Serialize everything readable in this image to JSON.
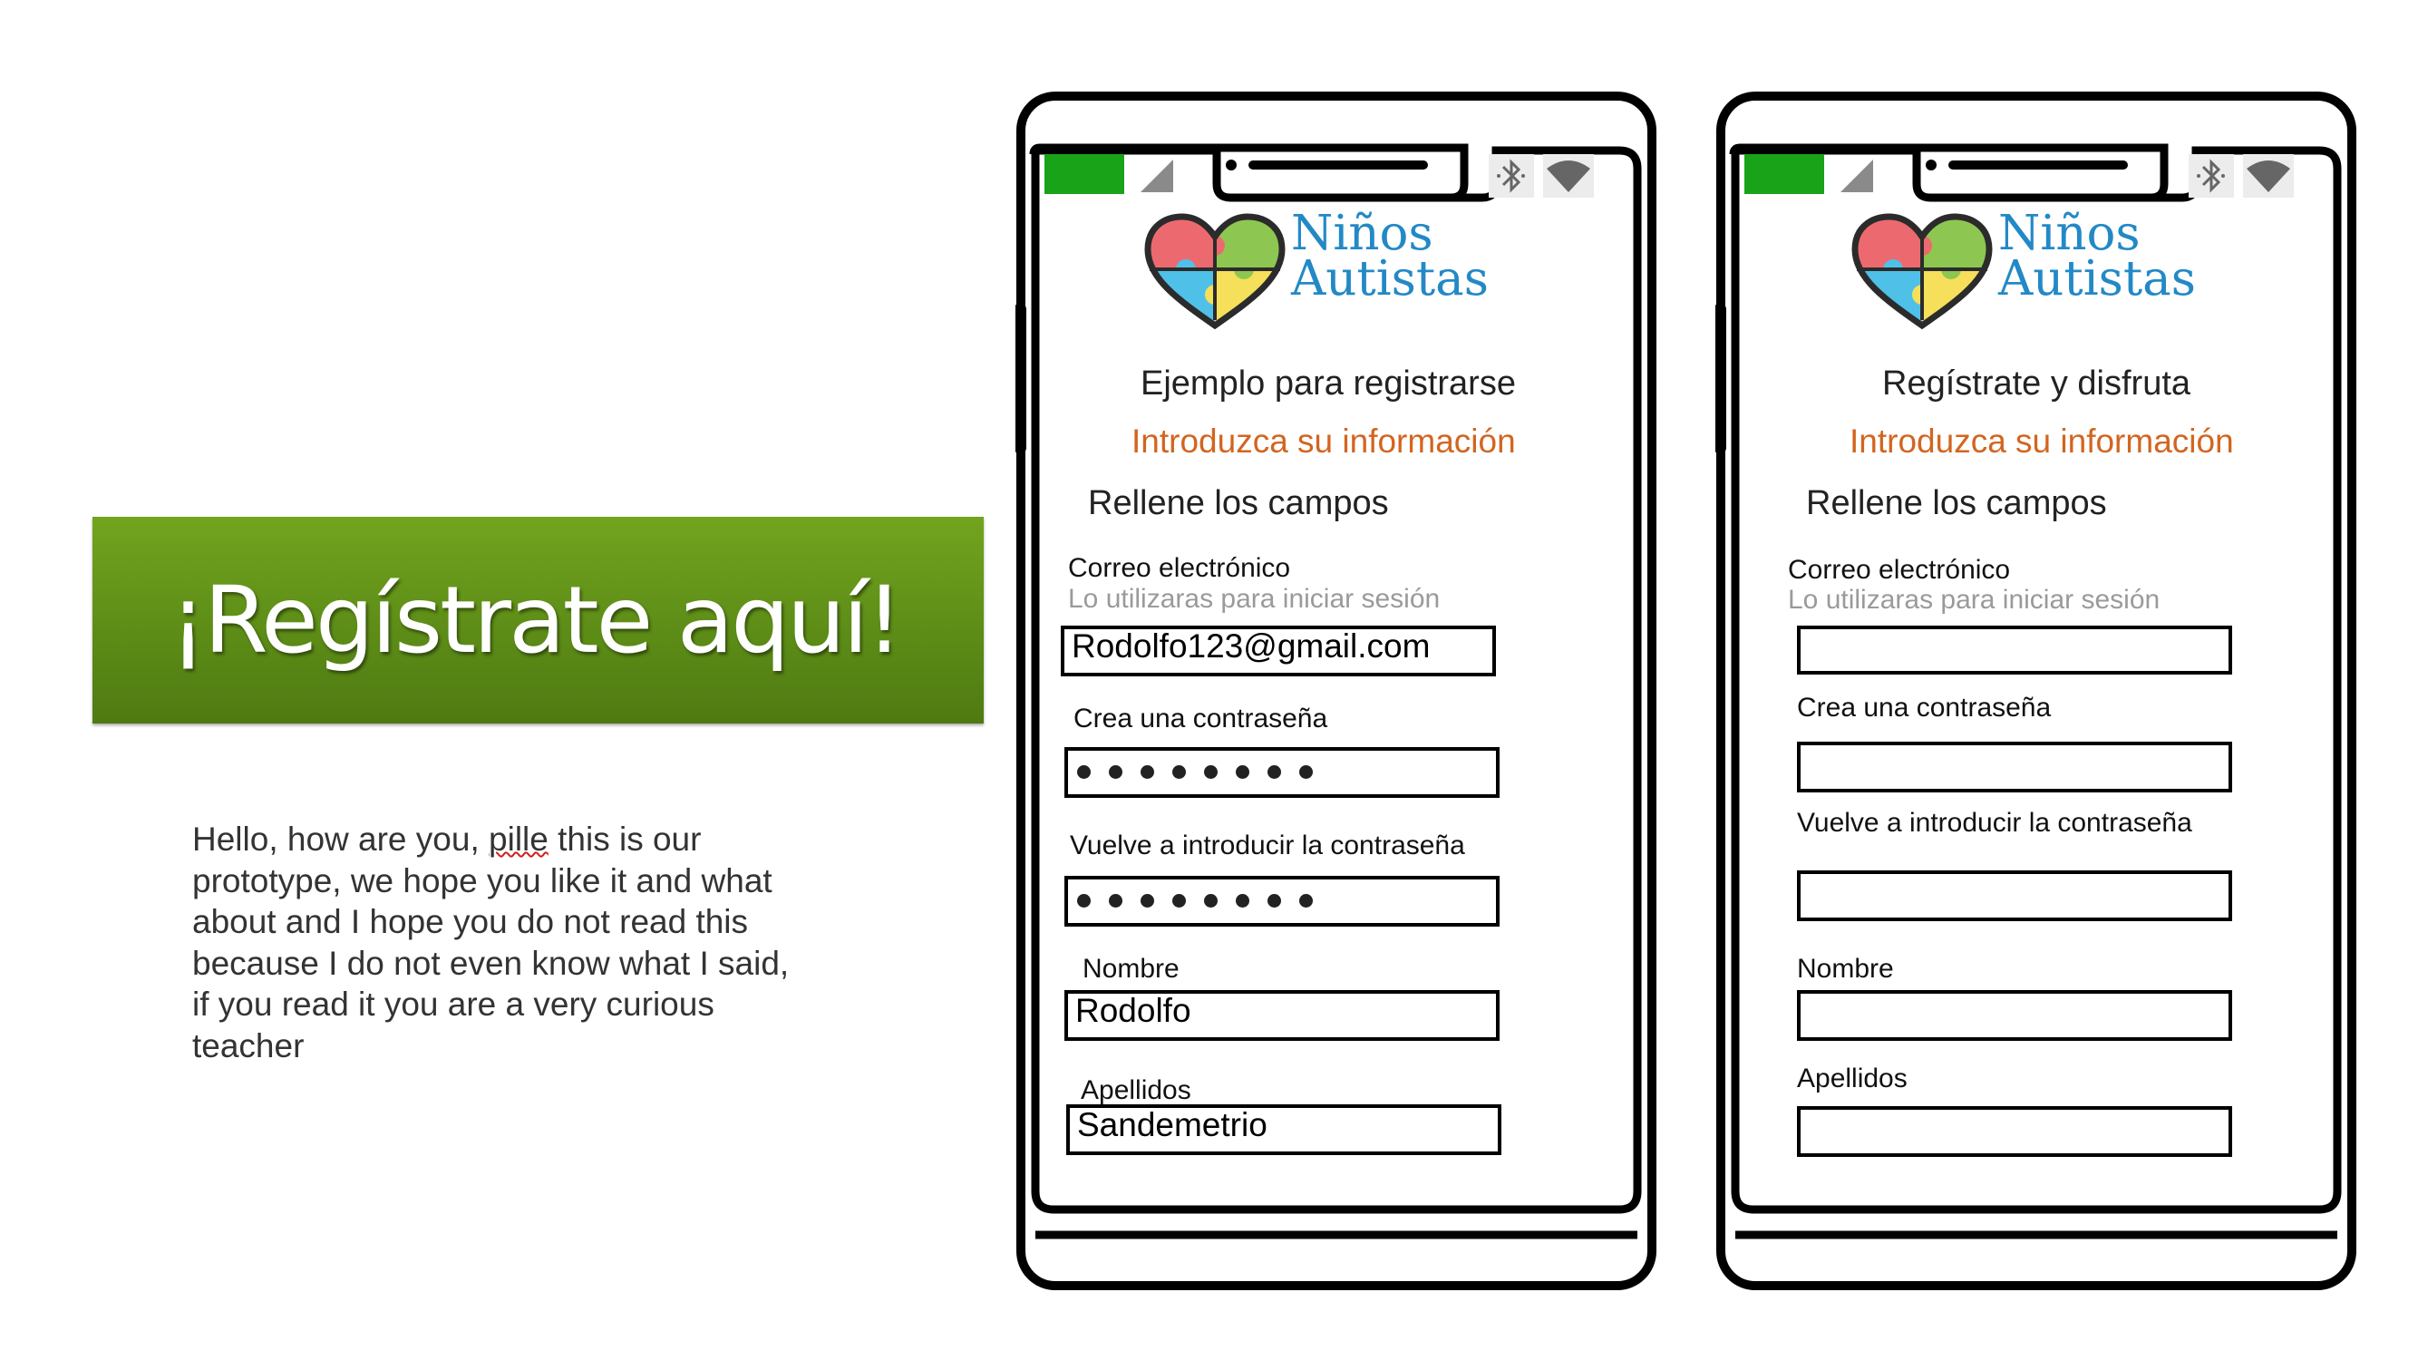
{
  "banner": {
    "text": "¡Regístrate aquí!"
  },
  "note": {
    "prefix": "Hello, how are you, ",
    "misspelled": "pille",
    "suffix": " this is our prototype, we hope you like it and what about and I hope you do not read this because I do not even know what I said, if you read it you are a very curious teacher"
  },
  "colors": {
    "banner": "#5d8d17",
    "accent": "#d26520",
    "logo_text": "#2389c6",
    "battery": "#19a319"
  },
  "phones": [
    {
      "logo": {
        "line1": "Niños",
        "line2": "Autistas"
      },
      "title": "Ejemplo para registrarse",
      "subtitle": "Introduzca su información",
      "instruction": "Rellene los campos",
      "fields": {
        "email_label": "Correo electrónico",
        "email_hint": "Lo utilizaras para iniciar sesión",
        "email_value": "Rodolfo123@gmail.com",
        "password_label": "Crea una contraseña",
        "password_dots": 8,
        "confirm_label": "Vuelve a introducir la contraseña",
        "confirm_dots": 8,
        "name_label": "Nombre",
        "name_value": "Rodolfo",
        "surname_label": "Apellidos",
        "surname_value": "Sandemetrio"
      }
    },
    {
      "logo": {
        "line1": "Niños",
        "line2": "Autistas"
      },
      "title": "Regístrate y disfruta",
      "subtitle": "Introduzca su información",
      "instruction": "Rellene los campos",
      "fields": {
        "email_label": "Correo electrónico",
        "email_hint": "Lo utilizaras para iniciar sesión",
        "email_value": "",
        "password_label": "Crea una contraseña",
        "confirm_label": "Vuelve a introducir la contraseña",
        "name_label": "Nombre",
        "name_value": "",
        "surname_label": "Apellidos",
        "surname_value": ""
      }
    }
  ],
  "icons": [
    "battery-icon",
    "signal-icon",
    "bluetooth-icon",
    "wifi-icon",
    "puzzle-heart-logo-icon"
  ]
}
